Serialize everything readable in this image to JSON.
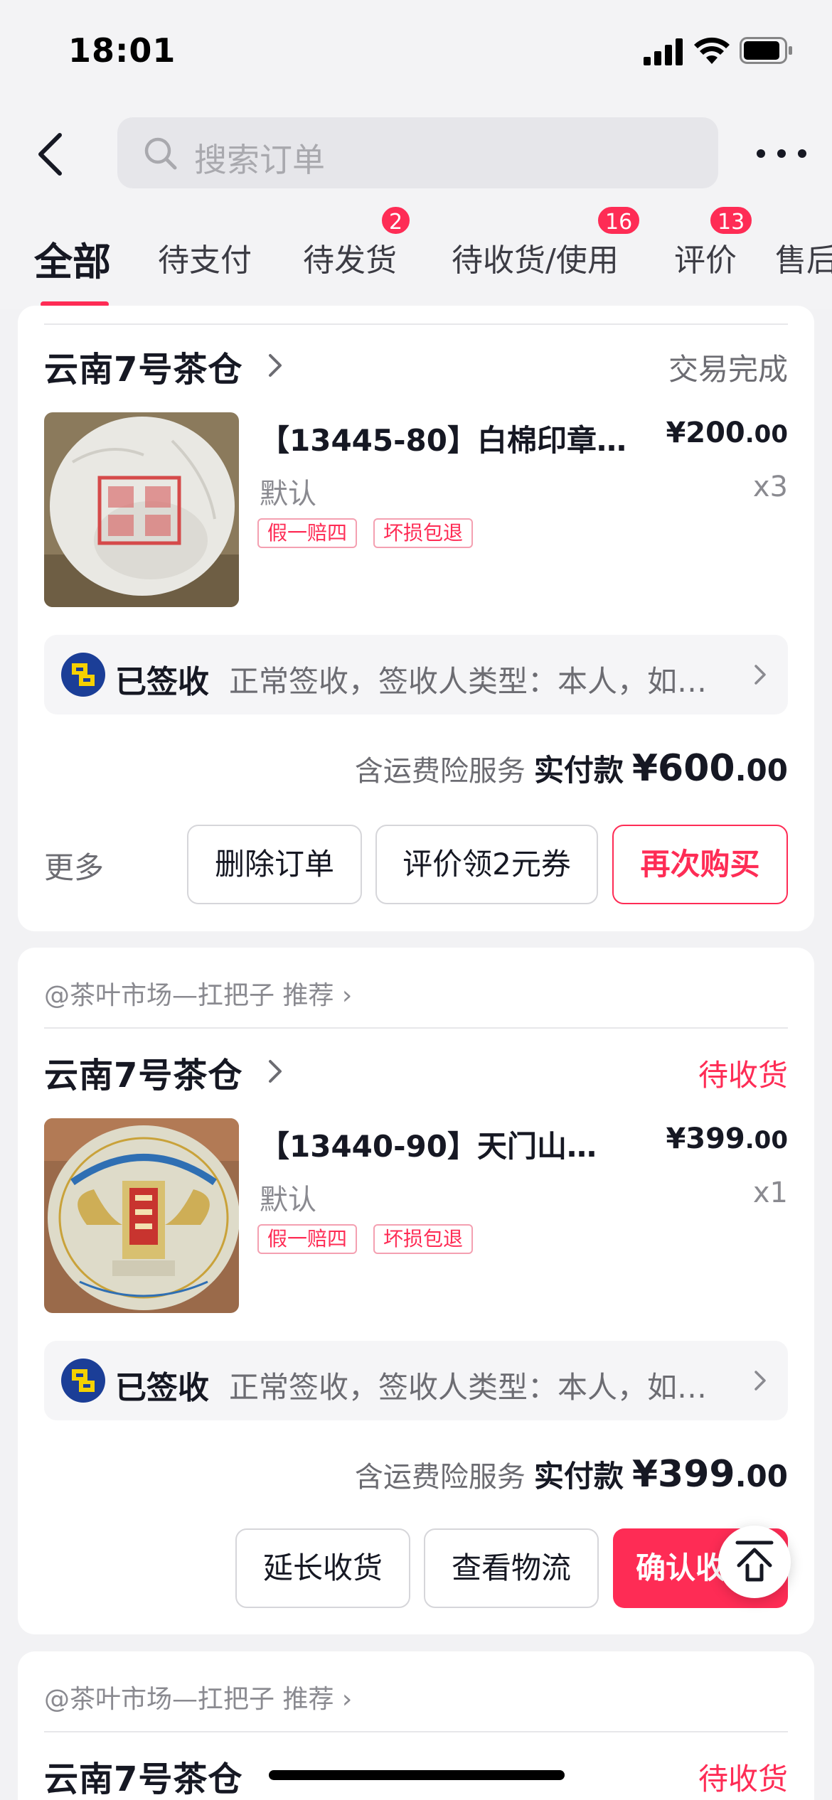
{
  "status_bar": {
    "time": "18:01"
  },
  "header": {
    "search_placeholder": "搜索订单"
  },
  "tabs": [
    {
      "label": "全部",
      "active": true
    },
    {
      "label": "待支付"
    },
    {
      "label": "待发货",
      "badge": "2"
    },
    {
      "label": "待收货/使用",
      "badge": "16"
    },
    {
      "label": "评价",
      "badge": "13"
    },
    {
      "label": "售后"
    }
  ],
  "orders": [
    {
      "shop": "云南7号茶仓",
      "status": "交易完成",
      "status_color": "#6c6c72",
      "product": {
        "title": "【13445-80】白棉印章…",
        "price_int": "¥200",
        "price_dec": ".00",
        "spec": "默认",
        "qty": "x3",
        "tags": [
          "假一赔四",
          "坏损包退"
        ]
      },
      "logistics": {
        "title": "已签收",
        "detail": "正常签收，签收人类型：本人，如…"
      },
      "total": {
        "service": "含运费险服务",
        "label": "实付款",
        "amount_int": "¥600",
        "amount_dec": ".00"
      },
      "more": "更多",
      "buttons": [
        "删除订单",
        "评价领2元券",
        "再次购买"
      ]
    },
    {
      "recommend": "@茶叶市场—扛把子 推荐",
      "shop": "云南7号茶仓",
      "status": "待收货",
      "status_color": "#fe2c55",
      "product": {
        "title": "【13440-90】天门山…",
        "price_int": "¥399",
        "price_dec": ".00",
        "spec": "默认",
        "qty": "x1",
        "tags": [
          "假一赔四",
          "坏损包退"
        ]
      },
      "logistics": {
        "title": "已签收",
        "detail": "正常签收，签收人类型：本人，如…"
      },
      "total": {
        "service": "含运费险服务",
        "label": "实付款",
        "amount_int": "¥399",
        "amount_dec": ".00"
      },
      "buttons": [
        "延长收货",
        "查看物流",
        "确认收货"
      ]
    },
    {
      "recommend": "@茶叶市场—扛把子 推荐",
      "shop": "云南7号茶仓",
      "status": "待收货"
    }
  ]
}
